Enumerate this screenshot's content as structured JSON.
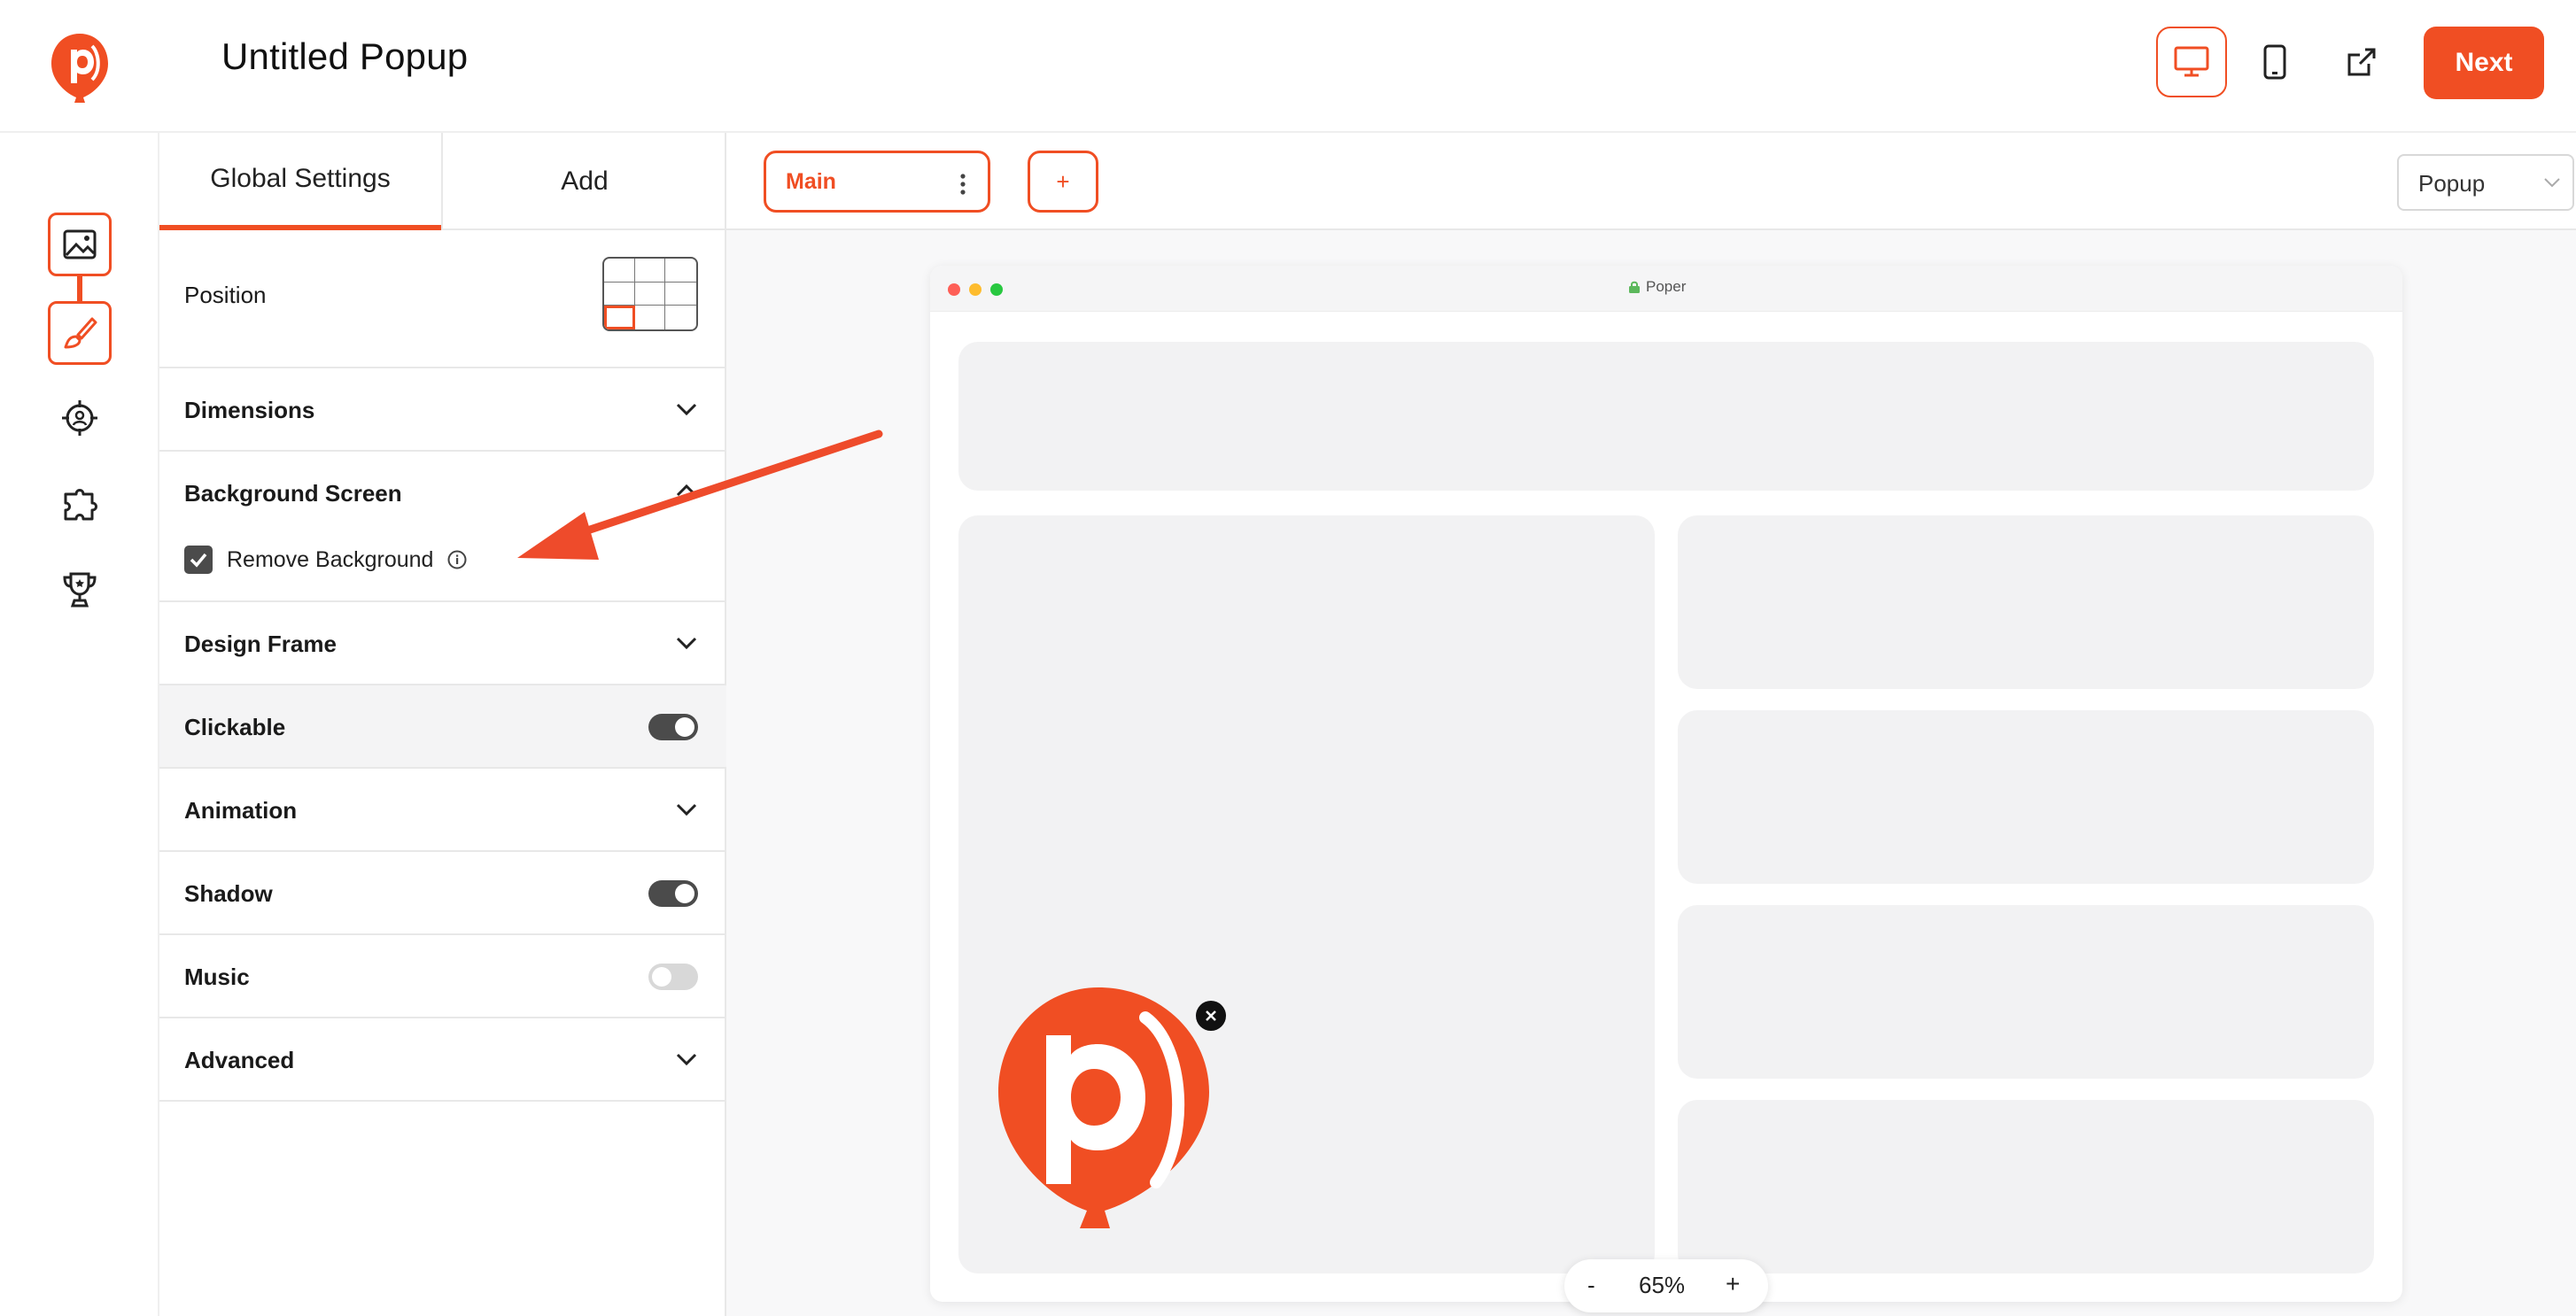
{
  "header": {
    "title": "Untitled Popup",
    "next_label": "Next"
  },
  "panel": {
    "tabs": [
      {
        "label": "Global Settings",
        "active": true
      },
      {
        "label": "Add",
        "active": false
      }
    ],
    "position_label": "Position",
    "position_selected_cell": "bottom-left",
    "dimensions_label": "Dimensions",
    "background_screen_label": "Background Screen",
    "remove_background_label": "Remove Background",
    "remove_background_checked": true,
    "design_frame_label": "Design Frame",
    "clickable_label": "Clickable",
    "clickable_on": true,
    "animation_label": "Animation",
    "shadow_label": "Shadow",
    "shadow_on": true,
    "music_label": "Music",
    "music_on": false,
    "advanced_label": "Advanced"
  },
  "canvas": {
    "step_tab_label": "Main",
    "add_step_label": "+",
    "view_select_value": "Popup",
    "browser_title": "Poper",
    "zoom_minus": "-",
    "zoom_value": "65%",
    "zoom_plus": "+"
  },
  "colors": {
    "accent": "#f04e23",
    "toggle_on": "#4b4b4b",
    "toggle_off": "#d8d8d8"
  },
  "icons": {
    "rail": [
      "image-icon",
      "brush-icon",
      "target-user-icon",
      "puzzle-icon",
      "trophy-icon"
    ],
    "devices": [
      "desktop-icon",
      "mobile-icon",
      "external-link-icon"
    ]
  }
}
